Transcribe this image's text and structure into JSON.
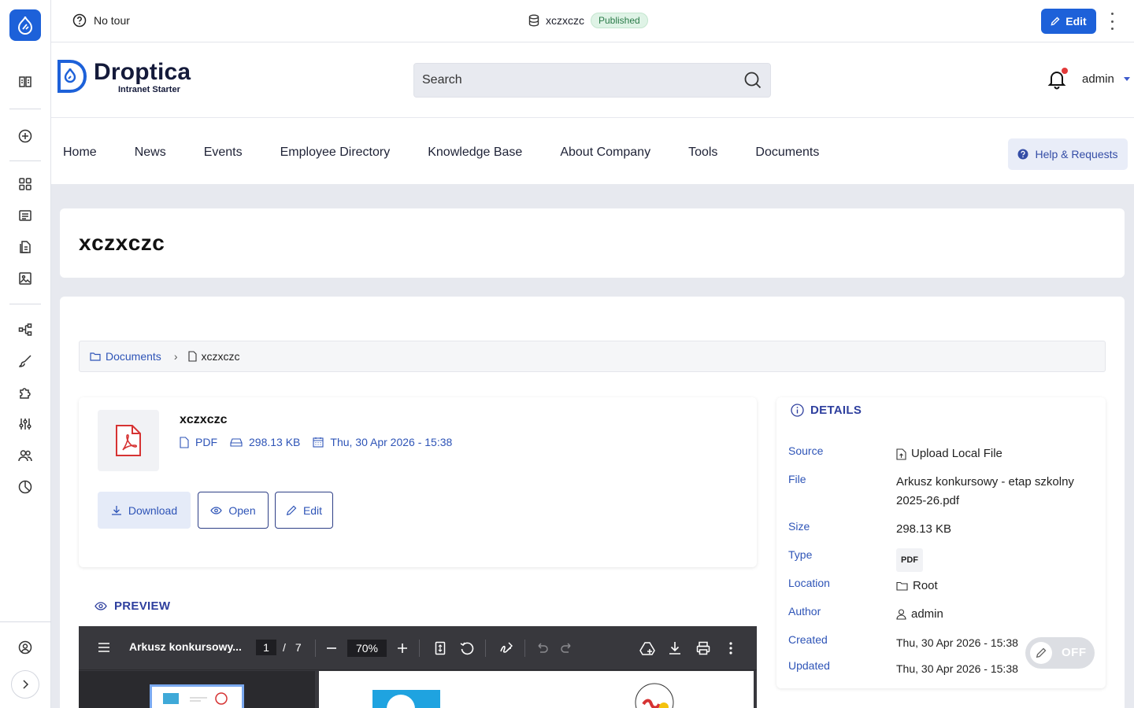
{
  "toolbar": {
    "tour_label": "No tour",
    "node_title": "xczxczc",
    "status_badge": "Published",
    "edit_label": "Edit"
  },
  "header": {
    "brand_name": "Droptica",
    "brand_tagline": "Intranet Starter",
    "search_placeholder": "Search",
    "user_name": "admin"
  },
  "nav": {
    "items": [
      "Home",
      "News",
      "Events",
      "Employee Directory",
      "Knowledge Base",
      "About Company",
      "Tools",
      "Documents"
    ],
    "help_label": "Help & Requests"
  },
  "page": {
    "title": "xczxczc"
  },
  "breadcrumb": {
    "parent": "Documents",
    "current": "xczxczc"
  },
  "file": {
    "name": "xczxczc",
    "type": "PDF",
    "size": "298.13 KB",
    "date": "Thu, 30 Apr 2026 - 15:38",
    "download_label": "Download",
    "open_label": "Open",
    "edit_label": "Edit"
  },
  "details": {
    "title": "DETAILS",
    "rows": [
      {
        "key": "Source",
        "value": "Upload Local File"
      },
      {
        "key": "File",
        "value": "Arkusz konkursowy - etap szkolny 2025-26.pdf"
      },
      {
        "key": "Size",
        "value": "298.13 KB"
      },
      {
        "key": "Type",
        "value": "PDF"
      },
      {
        "key": "Location",
        "value": "Root"
      },
      {
        "key": "Author",
        "value": "admin"
      },
      {
        "key": "Created",
        "value": "Thu, 30 Apr 2026 - 15:38"
      },
      {
        "key": "Updated",
        "value": "Thu, 30 Apr 2026 - 15:38"
      }
    ],
    "toggle_label": "OFF"
  },
  "preview": {
    "title": "PREVIEW",
    "doc_title": "Arkusz konkursowy...",
    "current_page": "1",
    "page_separator": "/",
    "total_pages": "7",
    "zoom": "70%"
  },
  "colors": {
    "accent": "#1d61d9",
    "link": "#2e54b7",
    "badge_bg": "#dff3e6",
    "badge_text": "#2a7a48"
  }
}
